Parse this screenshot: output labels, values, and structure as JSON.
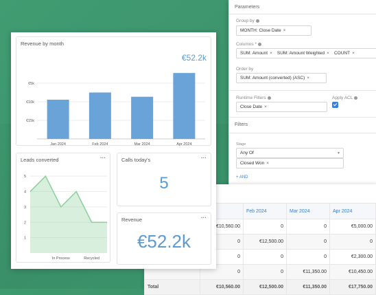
{
  "parameters": {
    "heading": "Parameters",
    "group_by": {
      "label": "Group by",
      "chips": [
        "MONTH: Close Date"
      ]
    },
    "columns": {
      "label": "Columns *",
      "chips": [
        "SUM: Amount",
        "SUM: Amount Weighted",
        "COUNT"
      ]
    },
    "order_by": {
      "label": "Order by",
      "chips": [
        "SUM: Amount (converted) (ASC)"
      ]
    },
    "runtime_filters": {
      "label": "Runtime Filters",
      "chips": [
        "Close Date"
      ]
    },
    "apply_acl": {
      "label": "Apply ACL",
      "checked": true
    },
    "filters_heading": "Filters",
    "stage_label": "Stage",
    "stage_operator": "Any Of",
    "stage_values": [
      "Closed Won"
    ],
    "add_link": "+ AND",
    "accent": "#3b7fd6"
  },
  "table": {
    "headers": [
      "",
      "24",
      "Feb 2024",
      "Mar 2024",
      "Apr 2024"
    ],
    "rows": [
      [
        "",
        "€10,560.00",
        "0",
        "0",
        "€5,000.00"
      ],
      [
        "",
        "0",
        "€12,500.00",
        "0",
        "0"
      ],
      [
        "",
        "0",
        "0",
        "0",
        "€2,300.00"
      ],
      [
        "",
        "0",
        "0",
        "€11,350.00",
        "€10,450.00"
      ]
    ],
    "total": [
      "Total",
      "€10,560.00",
      "€12,500.00",
      "€11,350.00",
      "€17,750.00"
    ]
  },
  "widgets": {
    "revenue_month": {
      "title": "Revenue by month",
      "kpi": "€52.2k",
      "menu": "···",
      "y_ticks": [
        "€15k",
        "€10k",
        "€5k"
      ]
    },
    "leads": {
      "title": "Leads converted",
      "menu": "···",
      "x_ticks": [
        "In Process",
        "Recycled"
      ]
    },
    "calls": {
      "title": "Calls today's",
      "menu": "···",
      "value": "5"
    },
    "revenue": {
      "title": "Revenue",
      "menu": "···",
      "value": "€52.2k"
    }
  },
  "chart_data": [
    {
      "type": "bar",
      "categories": [
        "Jan 2024",
        "Feb 2024",
        "Mar 2024",
        "Apr 2024"
      ],
      "values": [
        10560,
        12500,
        11350,
        17750
      ],
      "ylim": [
        0,
        20000
      ],
      "yticks": [
        5000,
        10000,
        15000
      ],
      "color": "#6aa3d8"
    },
    {
      "type": "area",
      "x": [
        0,
        1,
        2,
        3,
        4,
        5
      ],
      "values": [
        4,
        5,
        3,
        4,
        2,
        2
      ],
      "ylim": [
        0,
        5.5
      ],
      "yticks": [
        1,
        2,
        3,
        4,
        5
      ],
      "color": "#8fd19e"
    }
  ]
}
